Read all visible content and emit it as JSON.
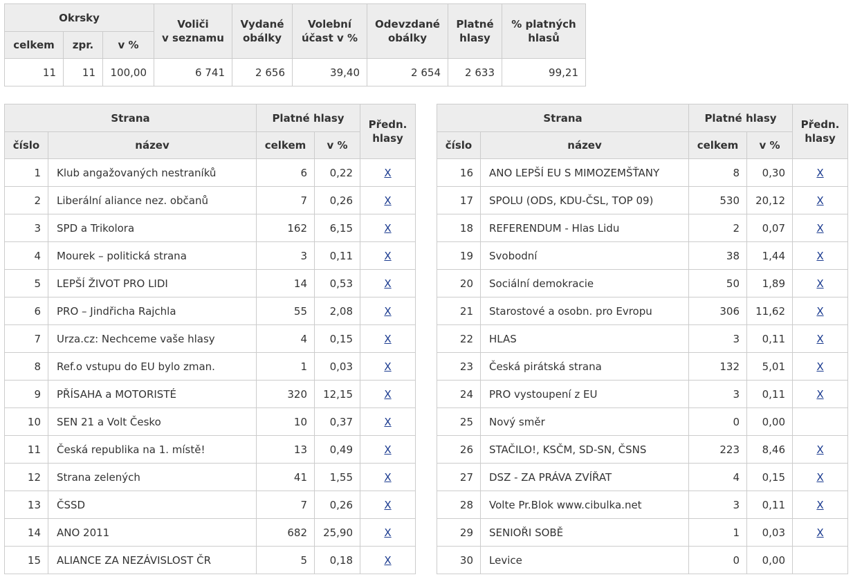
{
  "summary": {
    "headers": {
      "okrsky": "Okrsky",
      "celkem": "celkem",
      "zpr": "zpr.",
      "v_procentech": "v %",
      "volici_line1": "Voliči",
      "volici_line2": "v seznamu",
      "vydane_line1": "Vydané",
      "vydane_line2": "obálky",
      "ucast_line1": "Volební",
      "ucast_line2": "účast v %",
      "odevzdane_line1": "Odevzdané",
      "odevzdane_line2": "obálky",
      "platne_line1": "Platné",
      "platne_line2": "hlasy",
      "pct_platnych_line1": "% platných",
      "pct_platnych_line2": "hlasů"
    },
    "values": {
      "celkem": "11",
      "zpr": "11",
      "v_procentech": "100,00",
      "volici": "6 741",
      "vydane": "2 656",
      "ucast": "39,40",
      "odevzdane": "2 654",
      "platne": "2 633",
      "pct_platnych": "99,21"
    }
  },
  "party_headers": {
    "strana": "Strana",
    "platne_hlasy": "Platné hlasy",
    "predn_line1": "Předn.",
    "predn_line2": "hlasy",
    "cislo": "číslo",
    "nazev": "název",
    "celkem": "celkem",
    "v_procentech": "v %"
  },
  "parties_left": [
    {
      "cislo": "1",
      "nazev": "Klub angažovaných nestraníků",
      "celkem": "6",
      "pct": "0,22",
      "predn": "X"
    },
    {
      "cislo": "2",
      "nazev": "Liberální aliance nez. občanů",
      "celkem": "7",
      "pct": "0,26",
      "predn": "X"
    },
    {
      "cislo": "3",
      "nazev": "SPD a Trikolora",
      "celkem": "162",
      "pct": "6,15",
      "predn": "X"
    },
    {
      "cislo": "4",
      "nazev": "Mourek – politická strana",
      "celkem": "3",
      "pct": "0,11",
      "predn": "X"
    },
    {
      "cislo": "5",
      "nazev": "LEPŠÍ ŽIVOT PRO LIDI",
      "celkem": "14",
      "pct": "0,53",
      "predn": "X"
    },
    {
      "cislo": "6",
      "nazev": "PRO – Jindřicha Rajchla",
      "celkem": "55",
      "pct": "2,08",
      "predn": "X"
    },
    {
      "cislo": "7",
      "nazev": "Urza.cz: Nechceme vaše hlasy",
      "celkem": "4",
      "pct": "0,15",
      "predn": "X"
    },
    {
      "cislo": "8",
      "nazev": "Ref.o vstupu do EU bylo zman.",
      "celkem": "1",
      "pct": "0,03",
      "predn": "X"
    },
    {
      "cislo": "9",
      "nazev": "PŘÍSAHA a MOTORISTÉ",
      "celkem": "320",
      "pct": "12,15",
      "predn": "X"
    },
    {
      "cislo": "10",
      "nazev": "SEN 21 a Volt Česko",
      "celkem": "10",
      "pct": "0,37",
      "predn": "X"
    },
    {
      "cislo": "11",
      "nazev": "Česká republika na 1. místě!",
      "celkem": "13",
      "pct": "0,49",
      "predn": "X"
    },
    {
      "cislo": "12",
      "nazev": "Strana zelených",
      "celkem": "41",
      "pct": "1,55",
      "predn": "X"
    },
    {
      "cislo": "13",
      "nazev": "ČSSD",
      "celkem": "7",
      "pct": "0,26",
      "predn": "X"
    },
    {
      "cislo": "14",
      "nazev": "ANO 2011",
      "celkem": "682",
      "pct": "25,90",
      "predn": "X"
    },
    {
      "cislo": "15",
      "nazev": "ALIANCE ZA NEZÁVISLOST ČR",
      "celkem": "5",
      "pct": "0,18",
      "predn": "X"
    }
  ],
  "parties_right": [
    {
      "cislo": "16",
      "nazev": "ANO LEPŠÍ EU S MIMOZEMŠŤANY",
      "celkem": "8",
      "pct": "0,30",
      "predn": "X"
    },
    {
      "cislo": "17",
      "nazev": "SPOLU (ODS, KDU-ČSL, TOP 09)",
      "celkem": "530",
      "pct": "20,12",
      "predn": "X"
    },
    {
      "cislo": "18",
      "nazev": "REFERENDUM - Hlas Lidu",
      "celkem": "2",
      "pct": "0,07",
      "predn": "X"
    },
    {
      "cislo": "19",
      "nazev": "Svobodní",
      "celkem": "38",
      "pct": "1,44",
      "predn": "X"
    },
    {
      "cislo": "20",
      "nazev": "Sociální demokracie",
      "celkem": "50",
      "pct": "1,89",
      "predn": "X"
    },
    {
      "cislo": "21",
      "nazev": "Starostové a osobn. pro Evropu",
      "celkem": "306",
      "pct": "11,62",
      "predn": "X"
    },
    {
      "cislo": "22",
      "nazev": "HLAS",
      "celkem": "3",
      "pct": "0,11",
      "predn": "X"
    },
    {
      "cislo": "23",
      "nazev": "Česká pirátská strana",
      "celkem": "132",
      "pct": "5,01",
      "predn": "X"
    },
    {
      "cislo": "24",
      "nazev": "PRO vystoupení z EU",
      "celkem": "3",
      "pct": "0,11",
      "predn": "X"
    },
    {
      "cislo": "25",
      "nazev": "Nový směr",
      "celkem": "0",
      "pct": "0,00",
      "predn": ""
    },
    {
      "cislo": "26",
      "nazev": "STAČILO!, KSČM, SD-SN, ČSNS",
      "celkem": "223",
      "pct": "8,46",
      "predn": "X"
    },
    {
      "cislo": "27",
      "nazev": "DSZ - ZA PRÁVA ZVÍŘAT",
      "celkem": "4",
      "pct": "0,15",
      "predn": "X"
    },
    {
      "cislo": "28",
      "nazev": "Volte Pr.Blok www.cibulka.net",
      "celkem": "3",
      "pct": "0,11",
      "predn": "X"
    },
    {
      "cislo": "29",
      "nazev": "SENIOŘI SOBĚ",
      "celkem": "1",
      "pct": "0,03",
      "predn": "X"
    },
    {
      "cislo": "30",
      "nazev": "Levice",
      "celkem": "0",
      "pct": "0,00",
      "predn": ""
    }
  ]
}
